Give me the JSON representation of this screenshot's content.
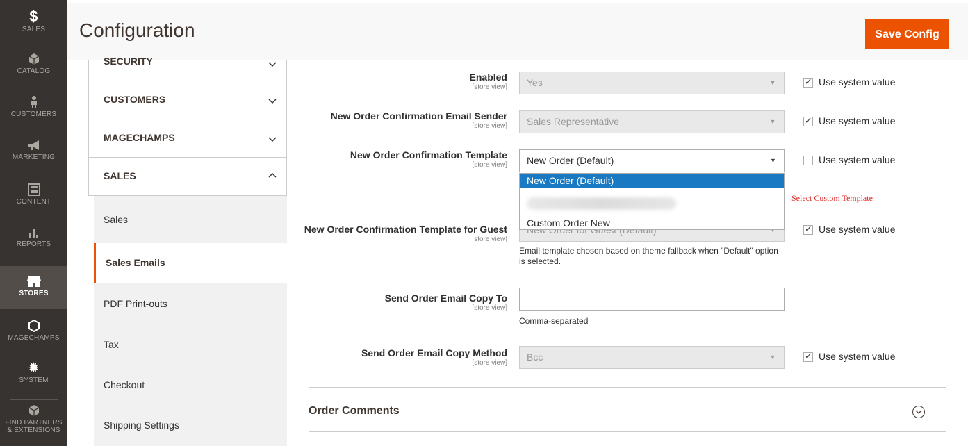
{
  "nav": {
    "items": [
      {
        "label": "SALES",
        "icon": "dollar-icon"
      },
      {
        "label": "CATALOG",
        "icon": "box-icon"
      },
      {
        "label": "CUSTOMERS",
        "icon": "person-icon"
      },
      {
        "label": "MARKETING",
        "icon": "megaphone-icon"
      },
      {
        "label": "CONTENT",
        "icon": "layout-icon"
      },
      {
        "label": "REPORTS",
        "icon": "bars-icon"
      },
      {
        "label": "STORES",
        "icon": "store-icon"
      },
      {
        "label": "MAGECHAMPS",
        "icon": "hexagon-icon"
      },
      {
        "label": "SYSTEM",
        "icon": "gear-icon"
      },
      {
        "label": "FIND PARTNERS & EXTENSIONS",
        "icon": "box-icon"
      }
    ]
  },
  "header": {
    "title": "Configuration",
    "save_label": "Save Config"
  },
  "sections": {
    "security": "SECURITY",
    "customers": "CUSTOMERS",
    "magechamps": "MAGECHAMPS",
    "sales": "SALES",
    "sales_items": [
      "Sales",
      "Sales Emails",
      "PDF Print-outs",
      "Tax",
      "Checkout",
      "Shipping Settings"
    ]
  },
  "form": {
    "scope": "[store view]",
    "use_system": "Use system value",
    "enabled": {
      "label": "Enabled",
      "value": "Yes"
    },
    "sender": {
      "label": "New Order Confirmation Email Sender",
      "value": "Sales Representative"
    },
    "template": {
      "label": "New Order Confirmation Template",
      "value": "New Order (Default)"
    },
    "guest": {
      "label": "New Order Confirmation Template for Guest",
      "value": "New Order for Guest (Default)",
      "note": "Email template chosen based on theme fallback when \"Default\" option is selected."
    },
    "copy_to": {
      "label": "Send Order Email Copy To",
      "value": "",
      "note": "Comma-separated"
    },
    "copy_method": {
      "label": "Send Order Email Copy Method",
      "value": "Bcc"
    }
  },
  "dropdown": {
    "options": [
      "New Order (Default)",
      "Custom Order New"
    ]
  },
  "annotation": "Select Custom Template",
  "order_comments": "Order Comments",
  "colors": {
    "accent": "#eb5202",
    "sidebar": "#373330",
    "selected": "#1979c3"
  }
}
